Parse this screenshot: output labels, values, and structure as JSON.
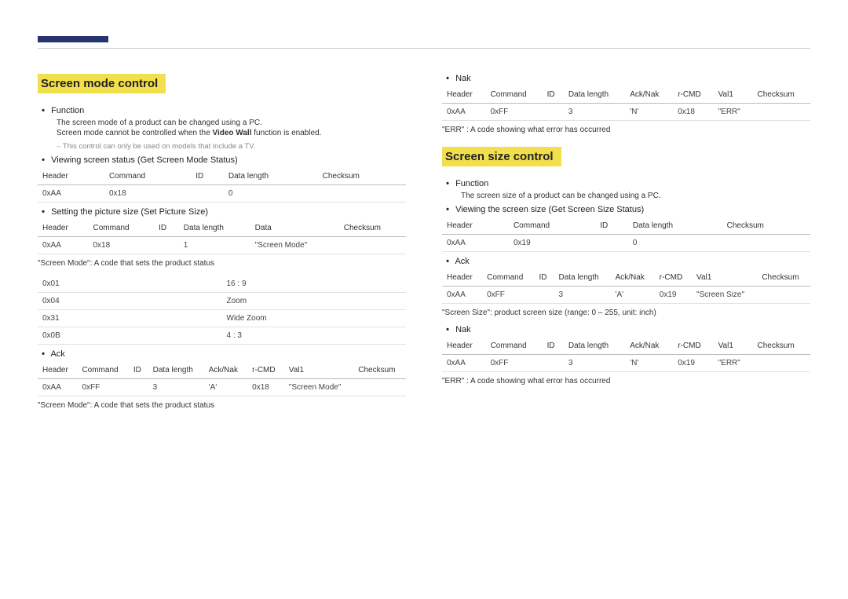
{
  "left": {
    "sectionTitle": "Screen mode control",
    "func": {
      "label": "Function",
      "line1": "The screen mode of a product can be changed using a PC.",
      "line2_pre": "Screen mode cannot be controlled when the ",
      "line2_bold": "Video Wall",
      "line2_post": " function is enabled.",
      "note": "This control can only be used on models that include a TV."
    },
    "view": {
      "label": "Viewing screen status (Get Screen Mode Status)",
      "headers": [
        "Header",
        "Command",
        "ID",
        "Data length",
        "Checksum"
      ],
      "row": [
        "0xAA",
        "0x18",
        "",
        "0",
        ""
      ]
    },
    "set": {
      "label": "Setting the picture size (Set Picture Size)",
      "headers": [
        "Header",
        "Command",
        "ID",
        "Data length",
        "Data",
        "Checksum"
      ],
      "row": [
        "0xAA",
        "0x18",
        "",
        "1",
        "\"Screen Mode\"",
        ""
      ]
    },
    "code_note": "\"Screen Mode\": A code that sets the product status",
    "modes": {
      "rows": [
        [
          "0x01",
          "16 : 9"
        ],
        [
          "0x04",
          "Zoom"
        ],
        [
          "0x31",
          "Wide Zoom"
        ],
        [
          "0x0B",
          "4 : 3"
        ]
      ]
    },
    "ack": {
      "label": "Ack",
      "headers": [
        "Header",
        "Command",
        "ID",
        "Data length",
        "Ack/Nak",
        "r-CMD",
        "Val1",
        "Checksum"
      ],
      "row": [
        "0xAA",
        "0xFF",
        "",
        "3",
        "'A'",
        "0x18",
        "\"Screen Mode\"",
        ""
      ]
    },
    "ack_note": "\"Screen Mode\": A code that sets the product status"
  },
  "right": {
    "nak": {
      "label": "Nak",
      "headers": [
        "Header",
        "Command",
        "ID",
        "Data length",
        "Ack/Nak",
        "r-CMD",
        "Val1",
        "Checksum"
      ],
      "row": [
        "0xAA",
        "0xFF",
        "",
        "3",
        "'N'",
        "0x18",
        "\"ERR\"",
        ""
      ]
    },
    "nak_note": "\"ERR\" : A code showing what error has occurred",
    "sectionTitle": "Screen size control",
    "func": {
      "label": "Function",
      "line1": "The screen size of a product can be changed using a PC."
    },
    "view": {
      "label": "Viewing the screen size (Get Screen Size Status)",
      "headers": [
        "Header",
        "Command",
        "ID",
        "Data length",
        "Checksum"
      ],
      "row": [
        "0xAA",
        "0x19",
        "",
        "0",
        ""
      ]
    },
    "ack": {
      "label": "Ack",
      "headers": [
        "Header",
        "Command",
        "ID",
        "Data length",
        "Ack/Nak",
        "r-CMD",
        "Val1",
        "Checksum"
      ],
      "row": [
        "0xAA",
        "0xFF",
        "",
        "3",
        "'A'",
        "0x19",
        "\"Screen Size\"",
        ""
      ]
    },
    "ack_note": "\"Screen Size\": product screen size (range: 0 – 255, unit: inch)",
    "nak2": {
      "label": "Nak",
      "headers": [
        "Header",
        "Command",
        "ID",
        "Data length",
        "Ack/Nak",
        "r-CMD",
        "Val1",
        "Checksum"
      ],
      "row": [
        "0xAA",
        "0xFF",
        "",
        "3",
        "'N'",
        "0x19",
        "\"ERR\"",
        ""
      ]
    },
    "nak2_note": "\"ERR\" : A code showing what error has occurred"
  }
}
